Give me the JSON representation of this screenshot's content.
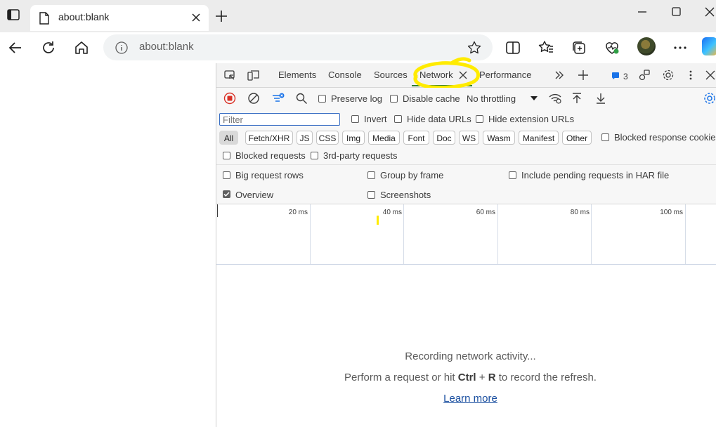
{
  "browser": {
    "tab": {
      "title": "about:blank"
    },
    "address": {
      "url": "about:blank"
    }
  },
  "devtools": {
    "tabs": [
      "Elements",
      "Console",
      "Sources",
      "Network",
      "Performance"
    ],
    "active_tab": "Network",
    "issues_count": "3",
    "highlight_color": "#ffeb00",
    "toolbar": {
      "preserve_log": "Preserve log",
      "disable_cache": "Disable cache",
      "throttling": "No throttling"
    },
    "filter": {
      "placeholder": "Filter",
      "invert": "Invert",
      "hide_data_urls": "Hide data URLs",
      "hide_extension_urls": "Hide extension URLs"
    },
    "type_filters": [
      "All",
      "Fetch/XHR",
      "JS",
      "CSS",
      "Img",
      "Media",
      "Font",
      "Doc",
      "WS",
      "Wasm",
      "Manifest",
      "Other"
    ],
    "active_type_filter": "All",
    "blocked_response_cookies": "Blocked response cookies",
    "blocked_requests": "Blocked requests",
    "third_party_requests": "3rd-party requests",
    "settings": {
      "big_request_rows": "Big request rows",
      "group_by_frame": "Group by frame",
      "include_pending": "Include pending requests in HAR file",
      "overview": "Overview",
      "screenshots": "Screenshots"
    },
    "overview_ticks": [
      "20 ms",
      "40 ms",
      "60 ms",
      "80 ms",
      "100 ms"
    ],
    "empty_state": {
      "title": "Recording network activity...",
      "hint_prefix": "Perform a request or hit ",
      "hint_key1": "Ctrl",
      "hint_plus": " + ",
      "hint_key2": "R",
      "hint_suffix": " to record the refresh.",
      "learn_more": "Learn more"
    }
  }
}
